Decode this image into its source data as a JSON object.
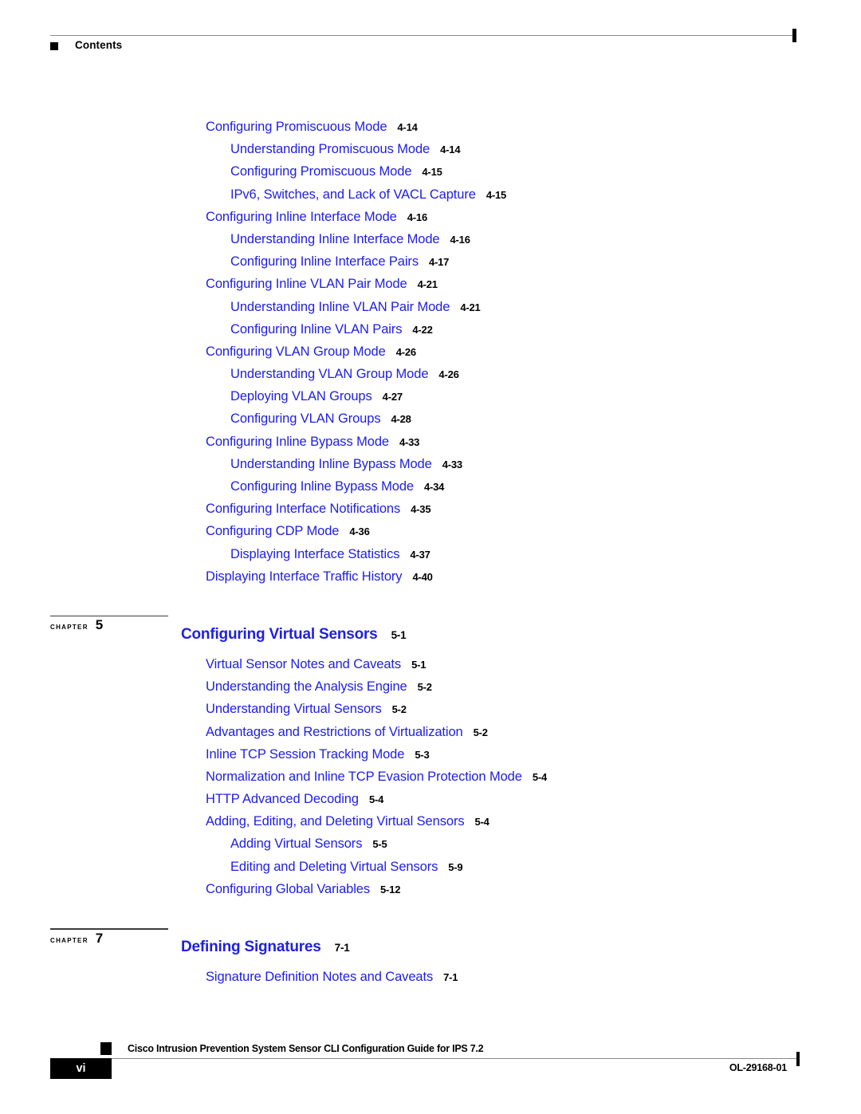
{
  "header": {
    "title": "Contents",
    "square_icon": "black-square-icon"
  },
  "colors": {
    "link_blue": "#2020E0",
    "text_black": "#000000",
    "rule_gray": "#8a8a8a"
  },
  "toc": {
    "groups": [
      {
        "entries": [
          {
            "level": 1,
            "title": "Configuring Promiscuous Mode",
            "page": "4-14"
          },
          {
            "level": 2,
            "title": "Understanding Promiscuous Mode",
            "page": "4-14"
          },
          {
            "level": 2,
            "title": "Configuring Promiscuous Mode",
            "page": "4-15"
          },
          {
            "level": 2,
            "title": "IPv6, Switches, and Lack of VACL Capture",
            "page": "4-15"
          },
          {
            "level": 1,
            "title": "Configuring Inline Interface Mode",
            "page": "4-16"
          },
          {
            "level": 2,
            "title": "Understanding Inline Interface Mode",
            "page": "4-16"
          },
          {
            "level": 2,
            "title": "Configuring Inline Interface Pairs",
            "page": "4-17"
          },
          {
            "level": 1,
            "title": "Configuring Inline VLAN Pair Mode",
            "page": "4-21"
          },
          {
            "level": 2,
            "title": "Understanding Inline VLAN Pair Mode",
            "page": "4-21"
          },
          {
            "level": 2,
            "title": "Configuring Inline VLAN Pairs",
            "page": "4-22"
          },
          {
            "level": 1,
            "title": "Configuring VLAN Group Mode",
            "page": "4-26"
          },
          {
            "level": 2,
            "title": "Understanding VLAN Group Mode",
            "page": "4-26"
          },
          {
            "level": 2,
            "title": "Deploying VLAN Groups",
            "page": "4-27"
          },
          {
            "level": 2,
            "title": "Configuring VLAN Groups",
            "page": "4-28"
          },
          {
            "level": 1,
            "title": "Configuring Inline Bypass Mode",
            "page": "4-33"
          },
          {
            "level": 2,
            "title": "Understanding Inline Bypass Mode",
            "page": "4-33"
          },
          {
            "level": 2,
            "title": "Configuring Inline Bypass Mode",
            "page": "4-34"
          },
          {
            "level": 1,
            "title": "Configuring Interface Notifications",
            "page": "4-35"
          },
          {
            "level": 1,
            "title": "Configuring CDP Mode",
            "page": "4-36"
          },
          {
            "level": 2,
            "title": "Displaying Interface Statistics",
            "page": "4-37"
          },
          {
            "level": 1,
            "title": "Displaying Interface Traffic History",
            "page": "4-40"
          }
        ]
      }
    ],
    "chapters": [
      {
        "chapter_word": "CHAPTER",
        "chapter_number": "5",
        "title": "Configuring Virtual Sensors",
        "page": "5-1",
        "entries": [
          {
            "level": 1,
            "title": "Virtual Sensor Notes and Caveats",
            "page": "5-1"
          },
          {
            "level": 1,
            "title": "Understanding the Analysis Engine",
            "page": "5-2"
          },
          {
            "level": 1,
            "title": "Understanding Virtual Sensors",
            "page": "5-2"
          },
          {
            "level": 1,
            "title": "Advantages and Restrictions of Virtualization",
            "page": "5-2"
          },
          {
            "level": 1,
            "title": "Inline TCP Session Tracking Mode",
            "page": "5-3"
          },
          {
            "level": 1,
            "title": "Normalization and Inline TCP Evasion Protection Mode",
            "page": "5-4"
          },
          {
            "level": 1,
            "title": "HTTP Advanced Decoding",
            "page": "5-4"
          },
          {
            "level": 1,
            "title": "Adding, Editing, and Deleting Virtual Sensors",
            "page": "5-4"
          },
          {
            "level": 2,
            "title": "Adding Virtual Sensors",
            "page": "5-5"
          },
          {
            "level": 2,
            "title": "Editing and Deleting Virtual Sensors",
            "page": "5-9"
          },
          {
            "level": 1,
            "title": "Configuring Global Variables",
            "page": "5-12"
          }
        ]
      },
      {
        "chapter_word": "CHAPTER",
        "chapter_number": "7",
        "title": "Defining Signatures",
        "page": "7-1",
        "entries": [
          {
            "level": 1,
            "title": "Signature Definition Notes and Caveats",
            "page": "7-1"
          }
        ]
      }
    ]
  },
  "footer": {
    "guide_title": "Cisco Intrusion Prevention System Sensor CLI Configuration Guide for IPS 7.2",
    "page_number": "vi",
    "document_id": "OL-29168-01",
    "square_icon": "black-square-icon"
  }
}
